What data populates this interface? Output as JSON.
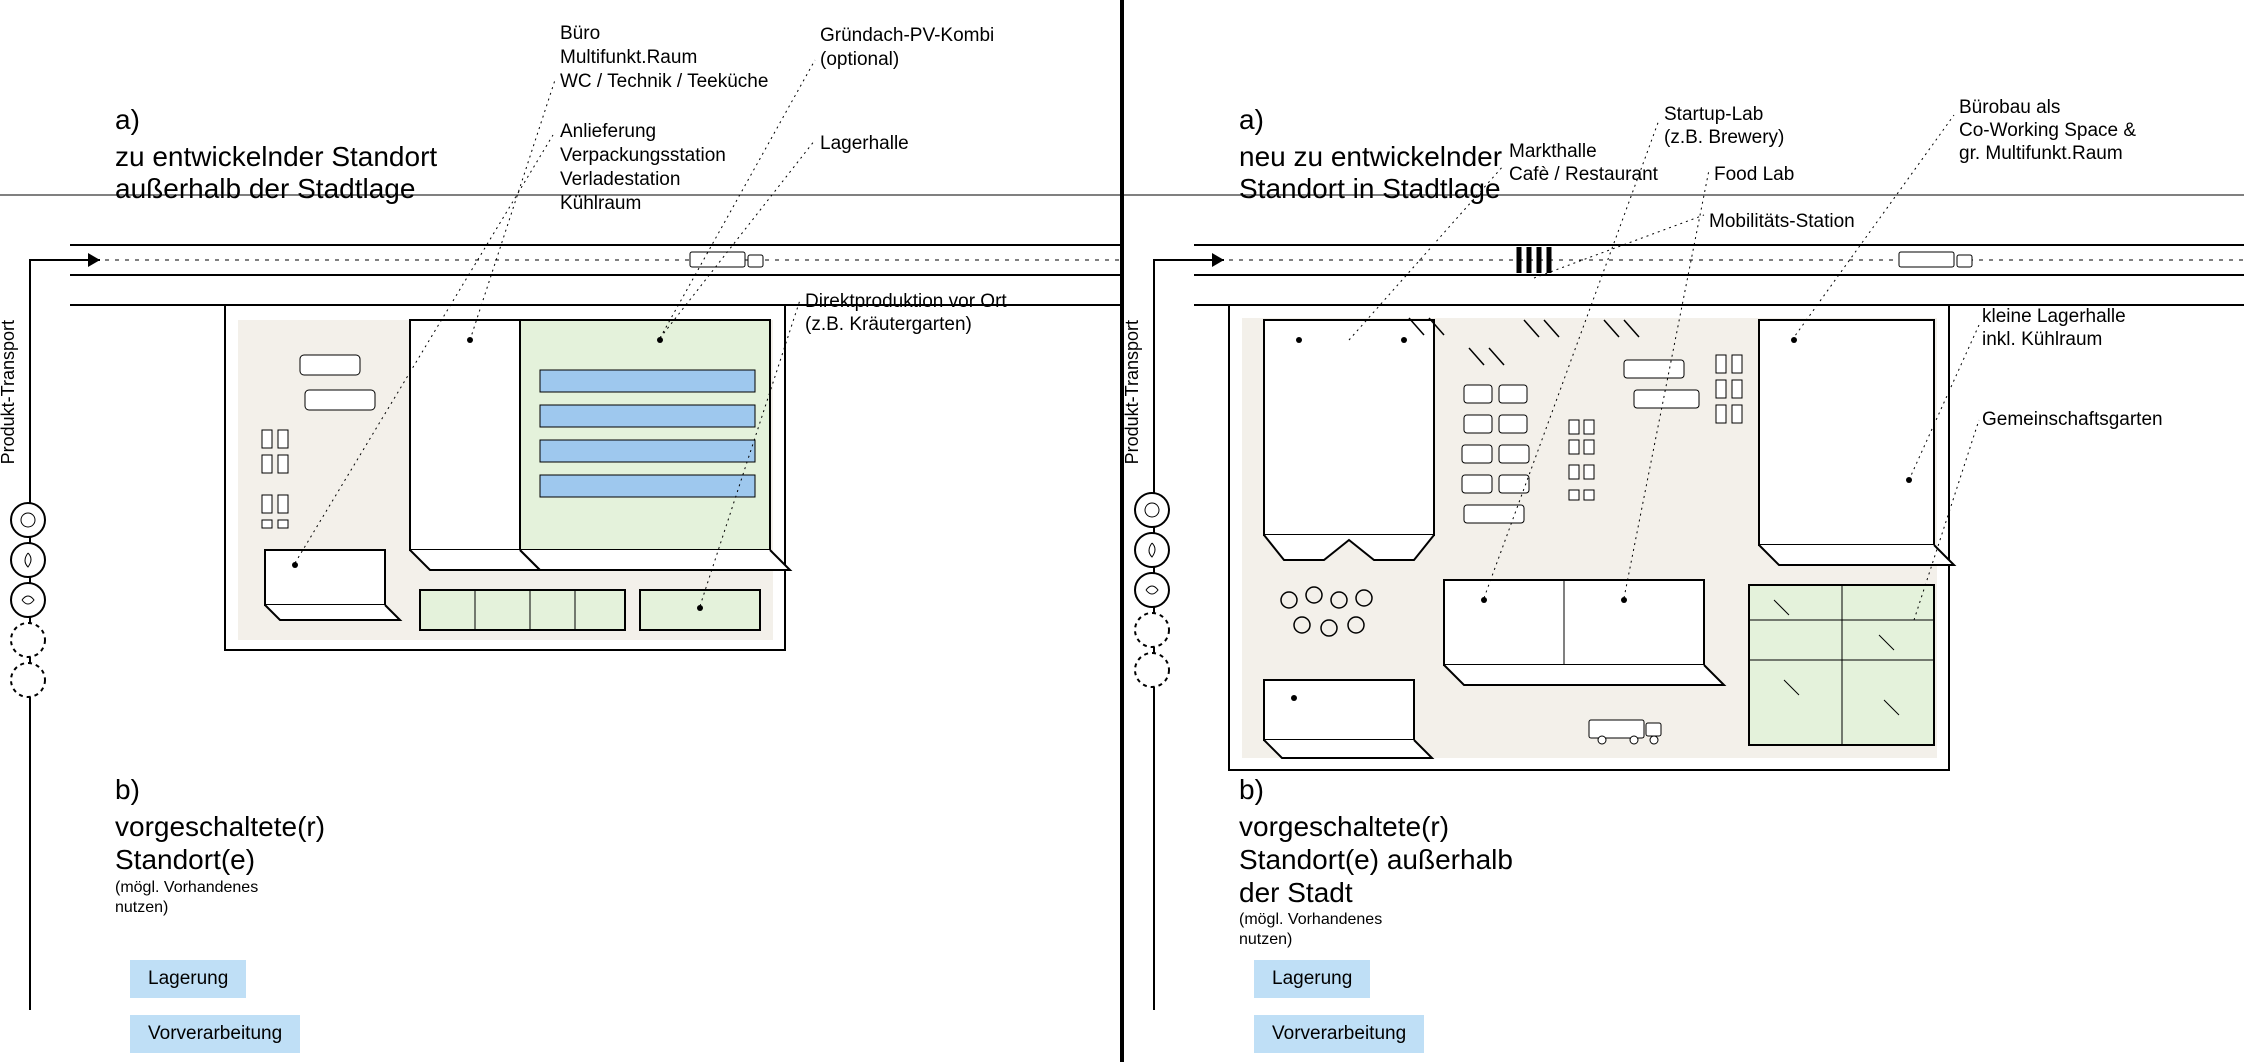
{
  "left": {
    "a_tag": "a)",
    "a_title_1": "zu entwickelnder Standort",
    "a_title_2": "außerhalb der Stadtlage",
    "callout_top1_1": "Büro",
    "callout_top1_2": "Multifunkt.Raum",
    "callout_top1_3": "WC / Technik / Teeküche",
    "callout_top2_1": "Gründach-PV-Kombi",
    "callout_top2_2": "(optional)",
    "callout_mid1_1": "Anlieferung",
    "callout_mid1_2": "Verpackungsstation",
    "callout_mid1_3": "Verladestation",
    "callout_mid1_4": "Kühlraum",
    "callout_mid2": "Lagerhalle",
    "callout_right_1": "Direktproduktion vor Ort",
    "callout_right_2": "(z.B. Kräutergarten)",
    "transport": "Produkt-Transport",
    "b_tag": "b)",
    "b_title_1": "vorgeschaltete(r)",
    "b_title_2": "Standort(e)",
    "b_sub_1": "(mögl. Vorhandenes",
    "b_sub_2": "nutzen)",
    "tag1": "Lagerung",
    "tag2": "Vorverarbeitung"
  },
  "right": {
    "a_tag": "a)",
    "a_title_1": "neu zu entwickelnder",
    "a_title_2": "Standort in Stadtlage",
    "callout_markthalle_1": "Markthalle",
    "callout_markthalle_2": "Cafè / Restaurant",
    "callout_startup_1": "Startup-Lab",
    "callout_startup_2": "(z.B. Brewery)",
    "callout_foodlab": "Food Lab",
    "callout_mobility": "Mobilitäts-Station",
    "callout_buero_1": "Bürobau als",
    "callout_buero_2": "Co-Working Space &",
    "callout_buero_3": "gr. Multifunkt.Raum",
    "callout_lager_1": "kleine Lagerhalle",
    "callout_lager_2": "inkl. Kühlraum",
    "callout_garden": "Gemeinschaftsgarten",
    "transport": "Produkt-Transport",
    "b_tag": "b)",
    "b_title_1": "vorgeschaltete(r)",
    "b_title_2": "Standort(e) außerhalb",
    "b_title_3": "der Stadt",
    "b_sub_1": "(mögl. Vorhandenes",
    "b_sub_2": "nutzen)",
    "tag1": "Lagerung",
    "tag2": "Vorverarbeitung"
  }
}
